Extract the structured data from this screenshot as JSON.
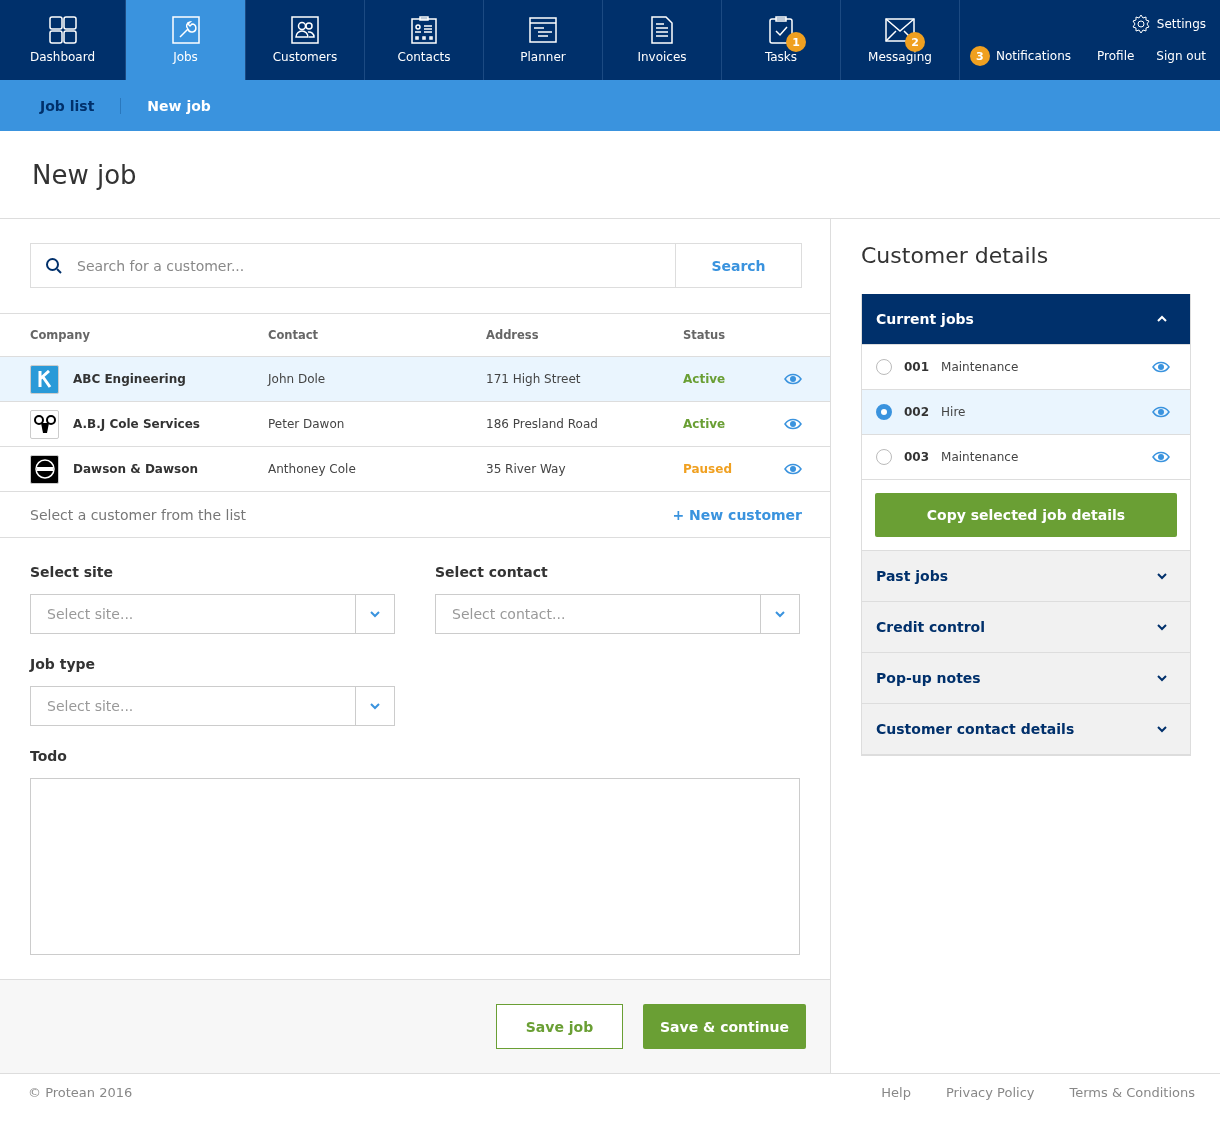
{
  "nav": {
    "items": [
      {
        "label": "Dashboard",
        "selected": false
      },
      {
        "label": "Jobs",
        "selected": true
      },
      {
        "label": "Customers",
        "selected": false
      },
      {
        "label": "Contacts",
        "selected": false
      },
      {
        "label": "Planner",
        "selected": false
      },
      {
        "label": "Invoices",
        "selected": false
      },
      {
        "label": "Tasks",
        "selected": false,
        "badge": "1"
      },
      {
        "label": "Messaging",
        "selected": false,
        "badge": "2"
      }
    ],
    "settings": "Settings",
    "notifications": {
      "label": "Notifications",
      "badge": "3"
    },
    "profile": "Profile",
    "sign_out": "Sign out"
  },
  "subnav": [
    {
      "label": "Job list",
      "selected": false
    },
    {
      "label": "New job",
      "selected": true
    }
  ],
  "page_title": "New job",
  "search": {
    "placeholder": "Search for a customer...",
    "button": "Search"
  },
  "table": {
    "columns": [
      "Company",
      "Contact",
      "Address",
      "Status"
    ],
    "rows": [
      {
        "company": "ABC Engineering",
        "contact": "John Dole",
        "address": "171 High Street",
        "status": "Active",
        "kind": "active",
        "selected": true
      },
      {
        "company": "A.B.J Cole Services",
        "contact": "Peter Dawon",
        "address": "186 Presland Road",
        "status": "Active",
        "kind": "active",
        "selected": false
      },
      {
        "company": "Dawson & Dawson",
        "contact": "Anthoney Cole",
        "address": "35 River Way",
        "status": "Paused",
        "kind": "paused",
        "selected": false
      }
    ]
  },
  "table_hint": "Select a customer from the list",
  "new_customer": "+ New customer",
  "form": {
    "site": {
      "label": "Select site",
      "placeholder": "Select site..."
    },
    "contact": {
      "label": "Select contact",
      "placeholder": "Select contact..."
    },
    "job_type": {
      "label": "Job type",
      "placeholder": "Select site..."
    },
    "todo": {
      "label": "Todo"
    }
  },
  "actions": {
    "save": "Save job",
    "save_continue": "Save & continue"
  },
  "customer_details": {
    "title": "Customer details",
    "current_jobs": {
      "title": "Current jobs",
      "expanded": true,
      "jobs": [
        {
          "number": "001",
          "type": "Maintenance",
          "selected": false
        },
        {
          "number": "002",
          "type": "Hire",
          "selected": true
        },
        {
          "number": "003",
          "type": "Maintenance",
          "selected": false
        }
      ],
      "copy_button": "Copy selected job details"
    },
    "sections": [
      {
        "title": "Past jobs",
        "expanded": false
      },
      {
        "title": "Credit control",
        "expanded": false
      },
      {
        "title": "Pop-up notes",
        "expanded": false
      },
      {
        "title": "Customer contact details",
        "expanded": false
      }
    ]
  },
  "footer": {
    "copyright": "© Protean 2016",
    "links": [
      "Help",
      "Privacy Policy",
      "Terms & Conditions"
    ]
  }
}
